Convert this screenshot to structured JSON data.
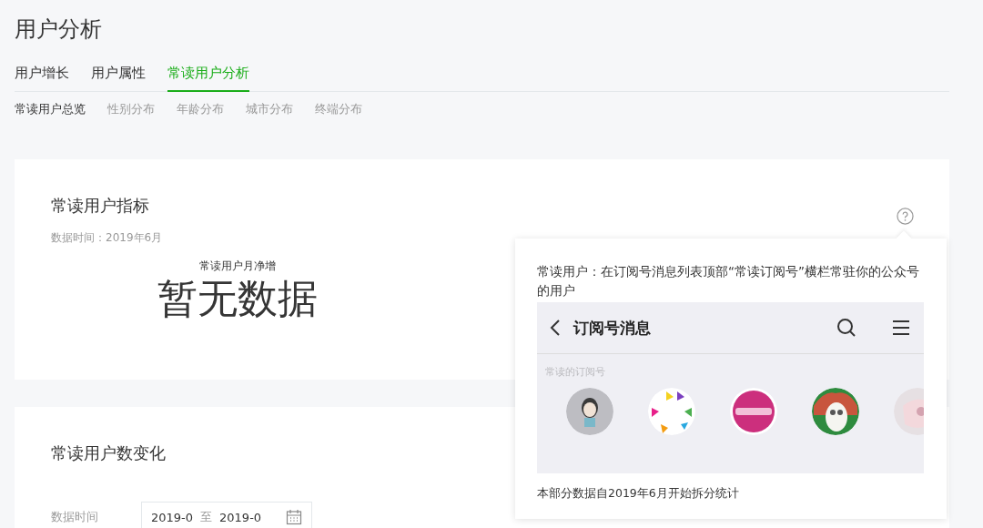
{
  "page_title": "用户分析",
  "tabs": [
    {
      "label": "用户增长",
      "selected": false
    },
    {
      "label": "用户属性",
      "selected": false
    },
    {
      "label": "常读用户分析",
      "selected": true
    }
  ],
  "subtabs": [
    {
      "label": "常读用户总览",
      "selected": true
    },
    {
      "label": "性别分布",
      "selected": false
    },
    {
      "label": "年龄分布",
      "selected": false
    },
    {
      "label": "城市分布",
      "selected": false
    },
    {
      "label": "终端分布",
      "selected": false
    }
  ],
  "metrics_card": {
    "title": "常读用户指标",
    "data_time": "数据时间：2019年6月",
    "metrics": [
      {
        "label": "常读用户月净增",
        "value": "暂无数据"
      }
    ]
  },
  "popover": {
    "description": "常读用户：在订阅号消息列表顶部“常读订阅号”横栏常驻你的公众号的用户",
    "preview": {
      "title": "订阅号消息",
      "section_label": "常读的订阅号"
    },
    "footnote": "本部分数据自2019年6月开始拆分统计"
  },
  "trend_card": {
    "title": "常读用户数变化",
    "date_label": "数据时间",
    "date_from": "2019-0",
    "date_separator": "至",
    "date_to": "2019-0"
  }
}
